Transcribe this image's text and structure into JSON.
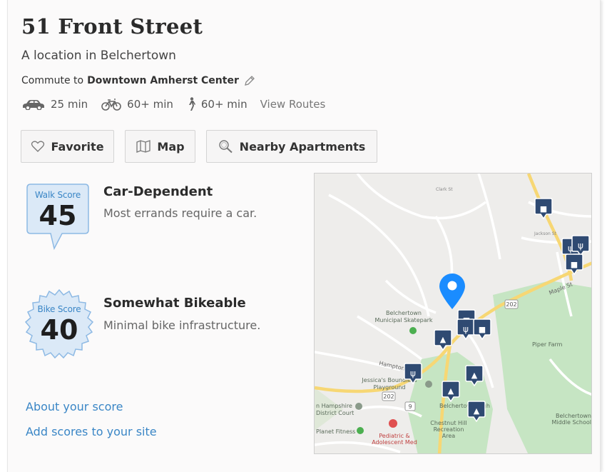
{
  "header": {
    "title": "51 Front Street",
    "subtitle": "A location in Belchertown",
    "commute_prefix": "Commute to",
    "commute_destination": "Downtown Amherst Center"
  },
  "modes": [
    {
      "icon": "car-icon",
      "label": "25 min"
    },
    {
      "icon": "bike-icon",
      "label": "60+ min"
    },
    {
      "icon": "walk-icon",
      "label": "60+ min"
    }
  ],
  "view_routes": "View Routes",
  "buttons": {
    "favorite": "Favorite",
    "map": "Map",
    "nearby": "Nearby Apartments"
  },
  "walk": {
    "badge_label": "Walk Score",
    "score": "45",
    "title": "Car-Dependent",
    "description": "Most errands require a car."
  },
  "bike": {
    "badge_label": "Bike Score",
    "score": "40",
    "title": "Somewhat Bikeable",
    "description": "Minimal bike infrastructure."
  },
  "links": {
    "about": "About your score",
    "add": "Add scores to your site"
  },
  "map": {
    "labels": {
      "skatepark": [
        "Belchertown",
        "Municipal Skatepark"
      ],
      "playground": [
        "Jessica's Boundless",
        "Playground"
      ],
      "high": "Belchertown High",
      "chestnut": [
        "Chestnut Hill",
        "Recreation",
        "Area"
      ],
      "piper": "Piper Farm",
      "middle": [
        "Belchertown",
        "Middle School"
      ],
      "court": [
        "n Hampshire",
        "District Court"
      ],
      "fitness": "Planet Fitness",
      "pediatric": [
        "Pediatric &",
        "Adolescent Med"
      ],
      "maple": "Maple St",
      "hampton": "Hampton Rd",
      "cove": "Clark St",
      "jackson": "Jackson St",
      "route202a": "202",
      "route202b": "202",
      "route9": "9"
    }
  },
  "colors": {
    "accent": "#3a86c6",
    "badge_fill": "#dbe9f7",
    "badge_border": "#8db9e4",
    "map_park": "#c6e5c3",
    "map_road": "#f7d774",
    "pin_blue": "#1a8cff",
    "poi_navy": "#2f4a72"
  }
}
